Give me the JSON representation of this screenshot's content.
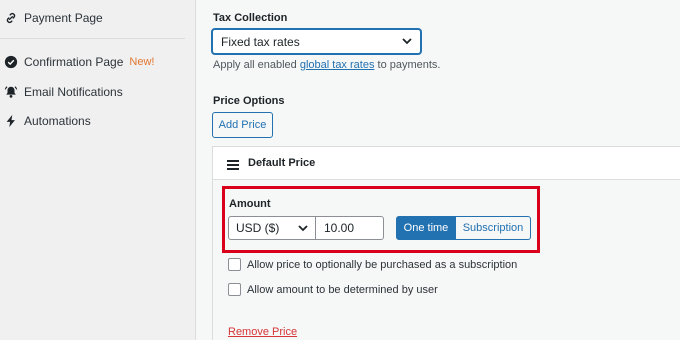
{
  "sidebar": {
    "items": [
      {
        "label": "Payment Page",
        "icon": "link-icon"
      },
      {
        "label": "Confirmation Page",
        "icon": "check-circle-icon",
        "badge": "New!"
      },
      {
        "label": "Email Notifications",
        "icon": "bell-icon"
      },
      {
        "label": "Automations",
        "icon": "lightning-icon"
      }
    ]
  },
  "tax": {
    "label": "Tax Collection",
    "selected": "Fixed tax rates",
    "help_prefix": "Apply all enabled ",
    "help_link": "global tax rates",
    "help_suffix": " to payments."
  },
  "price_options": {
    "label": "Price Options",
    "add_button": "Add Price"
  },
  "price_card": {
    "title": "Default Price",
    "amount_label": "Amount",
    "currency": "USD ($)",
    "amount": "10.00",
    "one_time": "One time",
    "subscription": "Subscription",
    "checkbox_subscription": "Allow price to optionally be purchased as a subscription",
    "checkbox_user_amount": "Allow amount to be determined by user",
    "remove": "Remove Price"
  },
  "colors": {
    "accent": "#2271b1",
    "highlight": "#d9001b",
    "new_badge": "#e27730",
    "danger": "#d63638"
  }
}
